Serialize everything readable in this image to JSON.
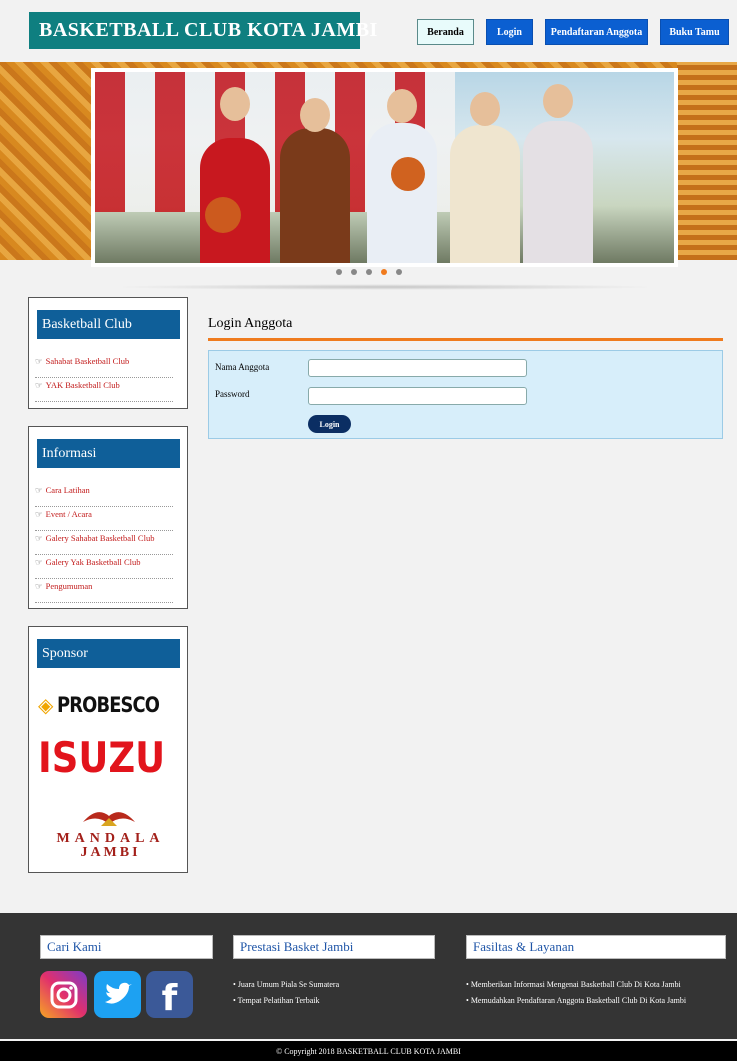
{
  "header": {
    "brand": "BASKETBALL CLUB KOTA JAMBI",
    "nav": [
      "Beranda",
      "Login",
      "Pendaftaran Anggota",
      "Buku Tamu"
    ]
  },
  "slider": {
    "dots": 5,
    "active_index": 3
  },
  "sidebar": {
    "club": {
      "title": "Basketball Club",
      "items": [
        "Sahabat Basketball Club",
        "YAK Basketball Club"
      ]
    },
    "info": {
      "title": "Informasi",
      "items": [
        "Cara Latihan",
        "Event / Acara",
        "Galery Sahabat Basketball Club",
        "Galery Yak Basketball Club",
        "Pengumuman"
      ]
    },
    "sponsor": {
      "title": "Sponsor",
      "logos": {
        "probesco": "PROBESCO",
        "isuzu": "ISUZU",
        "mandala": "MANDALA",
        "mandala_city": "JAMBI"
      }
    }
  },
  "login": {
    "title": "Login Anggota",
    "name_label": "Nama Anggota",
    "password_label": "Password",
    "button": "Login",
    "name_value": "",
    "password_value": ""
  },
  "footer": {
    "cari_title": "Cari Kami",
    "social_icons": [
      "instagram-icon",
      "twitter-icon",
      "facebook-icon"
    ],
    "prestasi_title": "Prestasi Basket Jambi",
    "prestasi_items": [
      "Juara Umum Piala Se Sumatera",
      "Tempat Pelatihan Terbaik"
    ],
    "fasilitas_title": "Fasiltas & Layanan",
    "fasilitas_items": [
      "Memberikan Informasi Mengenai Basketball Club Di Kota Jambi",
      "Memudahkan Pendaftaran Anggota Basketball Club Di Kota Jambi"
    ],
    "copyright": "© Copyright 2018 BASKETBALL CLUB KOTA JAMBI"
  },
  "colors": {
    "brand": "#0f7f80",
    "nav": "#0b5fd1",
    "accent": "#ef7b1e",
    "sidebar_title": "#0f5f99",
    "link": "#c21b1b"
  }
}
